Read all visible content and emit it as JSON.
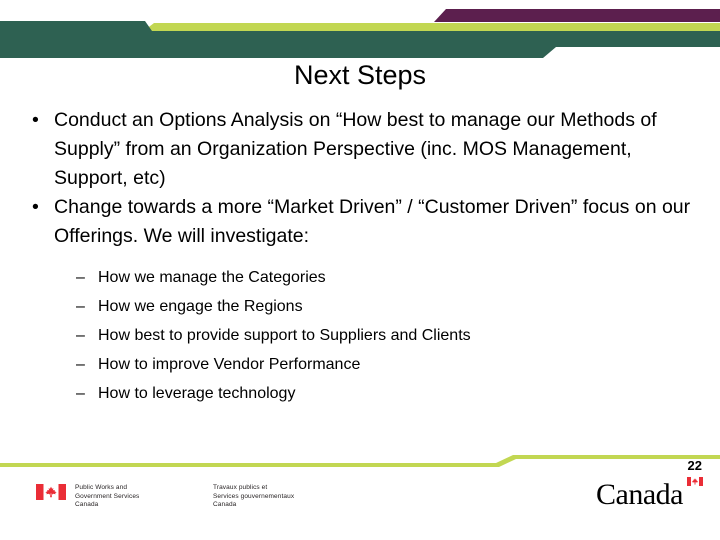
{
  "slide": {
    "title": "Next Steps",
    "number": "22"
  },
  "theme": {
    "dark_green": "#2E6152",
    "lime_green": "#C2D752",
    "purple": "#5C1F4E",
    "text_black": "#000000",
    "flag_red": "#EA2D36"
  },
  "content": {
    "bullet_char": "•",
    "dash_char": "–",
    "bullets": [
      {
        "text": "Conduct an Options Analysis on “How best to manage our Methods of Supply” from an Organization Perspective (inc. MOS Management, Support, etc)"
      },
      {
        "text": "Change towards a more “Market Driven” / “Customer Driven” focus on our Offerings.  We will investigate:",
        "sub_items": [
          "How we manage the Categories",
          "How we engage the Regions",
          "How best to provide support to Suppliers and Clients",
          "How to improve Vendor Performance",
          "How to leverage technology"
        ]
      }
    ]
  },
  "footer": {
    "signature": {
      "english": "Public Works and\nGovernment Services\nCanada",
      "french": "Travaux publics et\nServices gouvernementaux\nCanada"
    },
    "wordmark": "Canada"
  }
}
